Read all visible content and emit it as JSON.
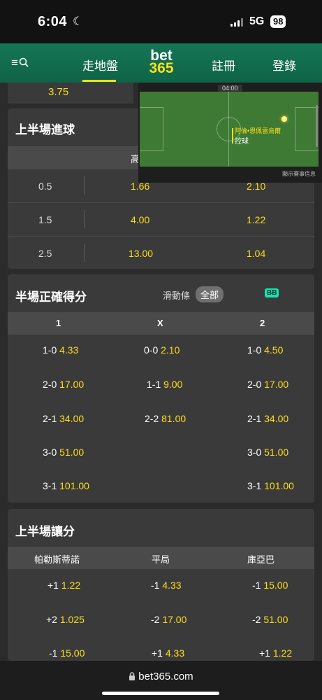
{
  "status": {
    "time": "6:04",
    "network": "5G",
    "battery": "98"
  },
  "header": {
    "tabs": [
      "走地盤",
      "註冊",
      "登錄"
    ],
    "logo_top": "bet",
    "logo_bottom": "365"
  },
  "partial_odds": "3.75",
  "video": {
    "clock": "04:00",
    "team": "阿倫•恩佩雷烏爾",
    "action": "控球",
    "info": "顯示賽事信息"
  },
  "first_half_goals": {
    "title": "上半場進球",
    "header_label": "高",
    "rows": [
      {
        "line": "0.5",
        "over": "1.66",
        "under": "2.10"
      },
      {
        "line": "1.5",
        "over": "4.00",
        "under": "1.22"
      },
      {
        "line": "2.5",
        "over": "13.00",
        "under": "1.04"
      }
    ]
  },
  "half_correct_score": {
    "title": "半場正確得分",
    "slider_label": "滑動條",
    "all_label": "全部",
    "bb_label": "BB",
    "columns": [
      "1",
      "X",
      "2"
    ],
    "home": [
      {
        "score": "1-0",
        "odds": "4.33"
      },
      {
        "score": "2-0",
        "odds": "17.00"
      },
      {
        "score": "2-1",
        "odds": "34.00"
      },
      {
        "score": "3-0",
        "odds": "51.00"
      },
      {
        "score": "3-1",
        "odds": "101.00"
      }
    ],
    "draw": [
      {
        "score": "0-0",
        "odds": "2.10"
      },
      {
        "score": "1-1",
        "odds": "9.00"
      },
      {
        "score": "2-2",
        "odds": "81.00"
      }
    ],
    "away": [
      {
        "score": "1-0",
        "odds": "4.50"
      },
      {
        "score": "2-0",
        "odds": "17.00"
      },
      {
        "score": "2-1",
        "odds": "34.00"
      },
      {
        "score": "3-0",
        "odds": "51.00"
      },
      {
        "score": "3-1",
        "odds": "101.00"
      }
    ]
  },
  "first_half_handicap": {
    "title": "上半場讓分",
    "columns": [
      "帕勒斯蒂諾",
      "平局",
      "庫亞巴"
    ],
    "rows": [
      [
        {
          "hcp": "+1",
          "odds": "1.22"
        },
        {
          "hcp": "-1",
          "odds": "4.33"
        },
        {
          "hcp": "-1",
          "odds": "15.00"
        }
      ],
      [
        {
          "hcp": "+2",
          "odds": "1.025"
        },
        {
          "hcp": "-2",
          "odds": "17.00"
        },
        {
          "hcp": "-2",
          "odds": "51.00"
        }
      ],
      [
        {
          "hcp": "-1",
          "odds": "15.00"
        },
        {
          "hcp": "+1",
          "odds": "4.33"
        },
        {
          "hcp": "+1",
          "odds": "1.22"
        }
      ]
    ]
  },
  "browser": {
    "url": "bet365.com"
  },
  "colors": {
    "header_green": "#126e51",
    "odds_yellow": "#ffdf1b",
    "bb_teal": "#14e5b0",
    "card_bg": "#3a3a3a"
  }
}
